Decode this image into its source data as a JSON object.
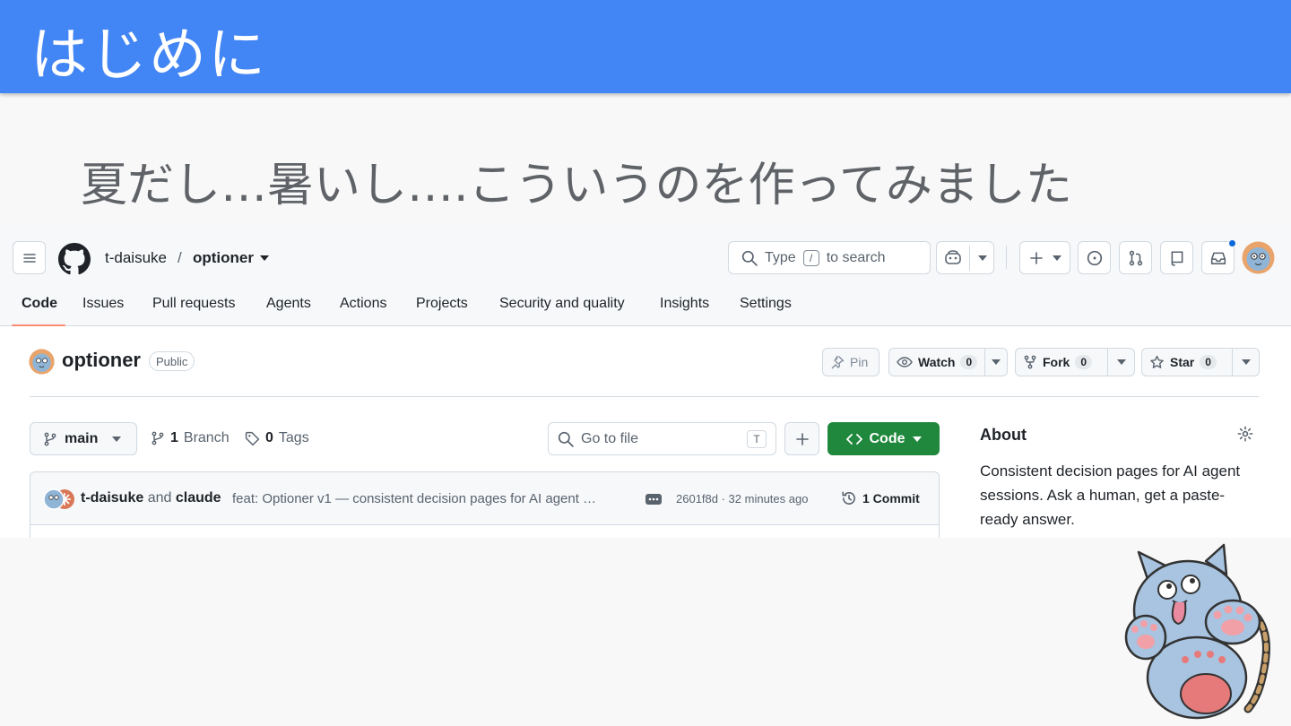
{
  "slide": {
    "title": "はじめに",
    "subtitle": "夏だし…暑いし….こういうのを作ってみました",
    "header_color": "#4285f4"
  },
  "github": {
    "owner": "t-daisuke",
    "separator": "/",
    "repo": "optioner",
    "search_prefix": "Type",
    "search_key": "/",
    "search_suffix": "to search",
    "tabs": [
      "Code",
      "Issues",
      "Pull requests",
      "Agents",
      "Actions",
      "Projects",
      "Security and quality",
      "Insights",
      "Settings"
    ],
    "active_tab": "Code",
    "repo_title": "optioner",
    "visibility": "Public",
    "pin_label": "Pin",
    "watch_label": "Watch",
    "watch_count": "0",
    "fork_label": "Fork",
    "fork_count": "0",
    "star_label": "Star",
    "star_count": "0",
    "branch": "main",
    "branch_count": "1",
    "branch_label": "Branch",
    "tag_count": "0",
    "tag_label": "Tags",
    "go_to_file_placeholder": "Go to file",
    "go_to_file_key": "T",
    "code_button": "Code",
    "commit": {
      "author1": "t-daisuke",
      "and": "and",
      "author2": "claude",
      "message": "feat: Optioner v1 — consistent decision pages for AI agent …",
      "hash_time": "2601f8d · 32 minutes ago",
      "count_label": "1 Commit"
    },
    "about_title": "About",
    "about_desc": "Consistent decision pages for AI agent sessions. Ask a human, get a paste-ready answer.",
    "accent_green": "#1f883d",
    "tab_underline_color": "#fd8c73"
  }
}
